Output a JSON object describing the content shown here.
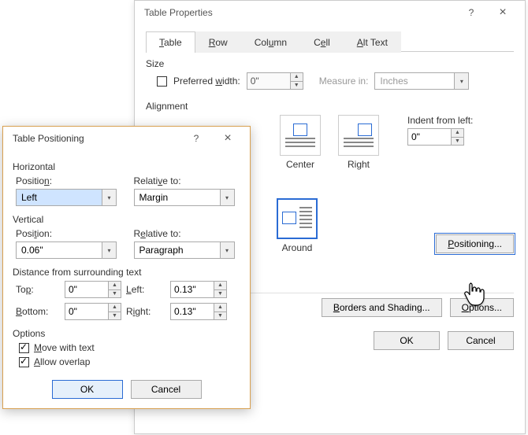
{
  "props": {
    "title": "Table Properties",
    "help": "?",
    "close": "×",
    "tabs": {
      "table": "Table",
      "row": "Row",
      "column": "Column",
      "cell": "Cell",
      "alt": "Alt Text"
    },
    "size": {
      "label": "Size",
      "pref": "Preferred width:",
      "val": "0\"",
      "meas": "Measure in:",
      "unit": "Inches"
    },
    "align": {
      "label": "Alignment",
      "center": "Center",
      "right": "Right",
      "indent": "Indent from left:",
      "indentVal": "0\""
    },
    "wrap": {
      "around": "Around",
      "pos": "Positioning..."
    },
    "borders": "Borders and Shading...",
    "options": "Options...",
    "ok": "OK",
    "cancel": "Cancel"
  },
  "pos": {
    "title": "Table Positioning",
    "help": "?",
    "close": "×",
    "horiz": "Horizontal",
    "vert": "Vertical",
    "posLbl": "Position:",
    "relLbl": "Relative to:",
    "hPos": "Left",
    "hRel": "Margin",
    "vPos": "0.06\"",
    "vRel": "Paragraph",
    "dist": "Distance from surrounding text",
    "top": "Top:",
    "bottom": "Bottom:",
    "left": "Left:",
    "right": "Right:",
    "tVal": "0\"",
    "bVal": "0\"",
    "lVal": "0.13\"",
    "rVal": "0.13\"",
    "opts": "Options",
    "move": "Move with text",
    "overlap": "Allow overlap",
    "ok": "OK",
    "cancel": "Cancel"
  }
}
